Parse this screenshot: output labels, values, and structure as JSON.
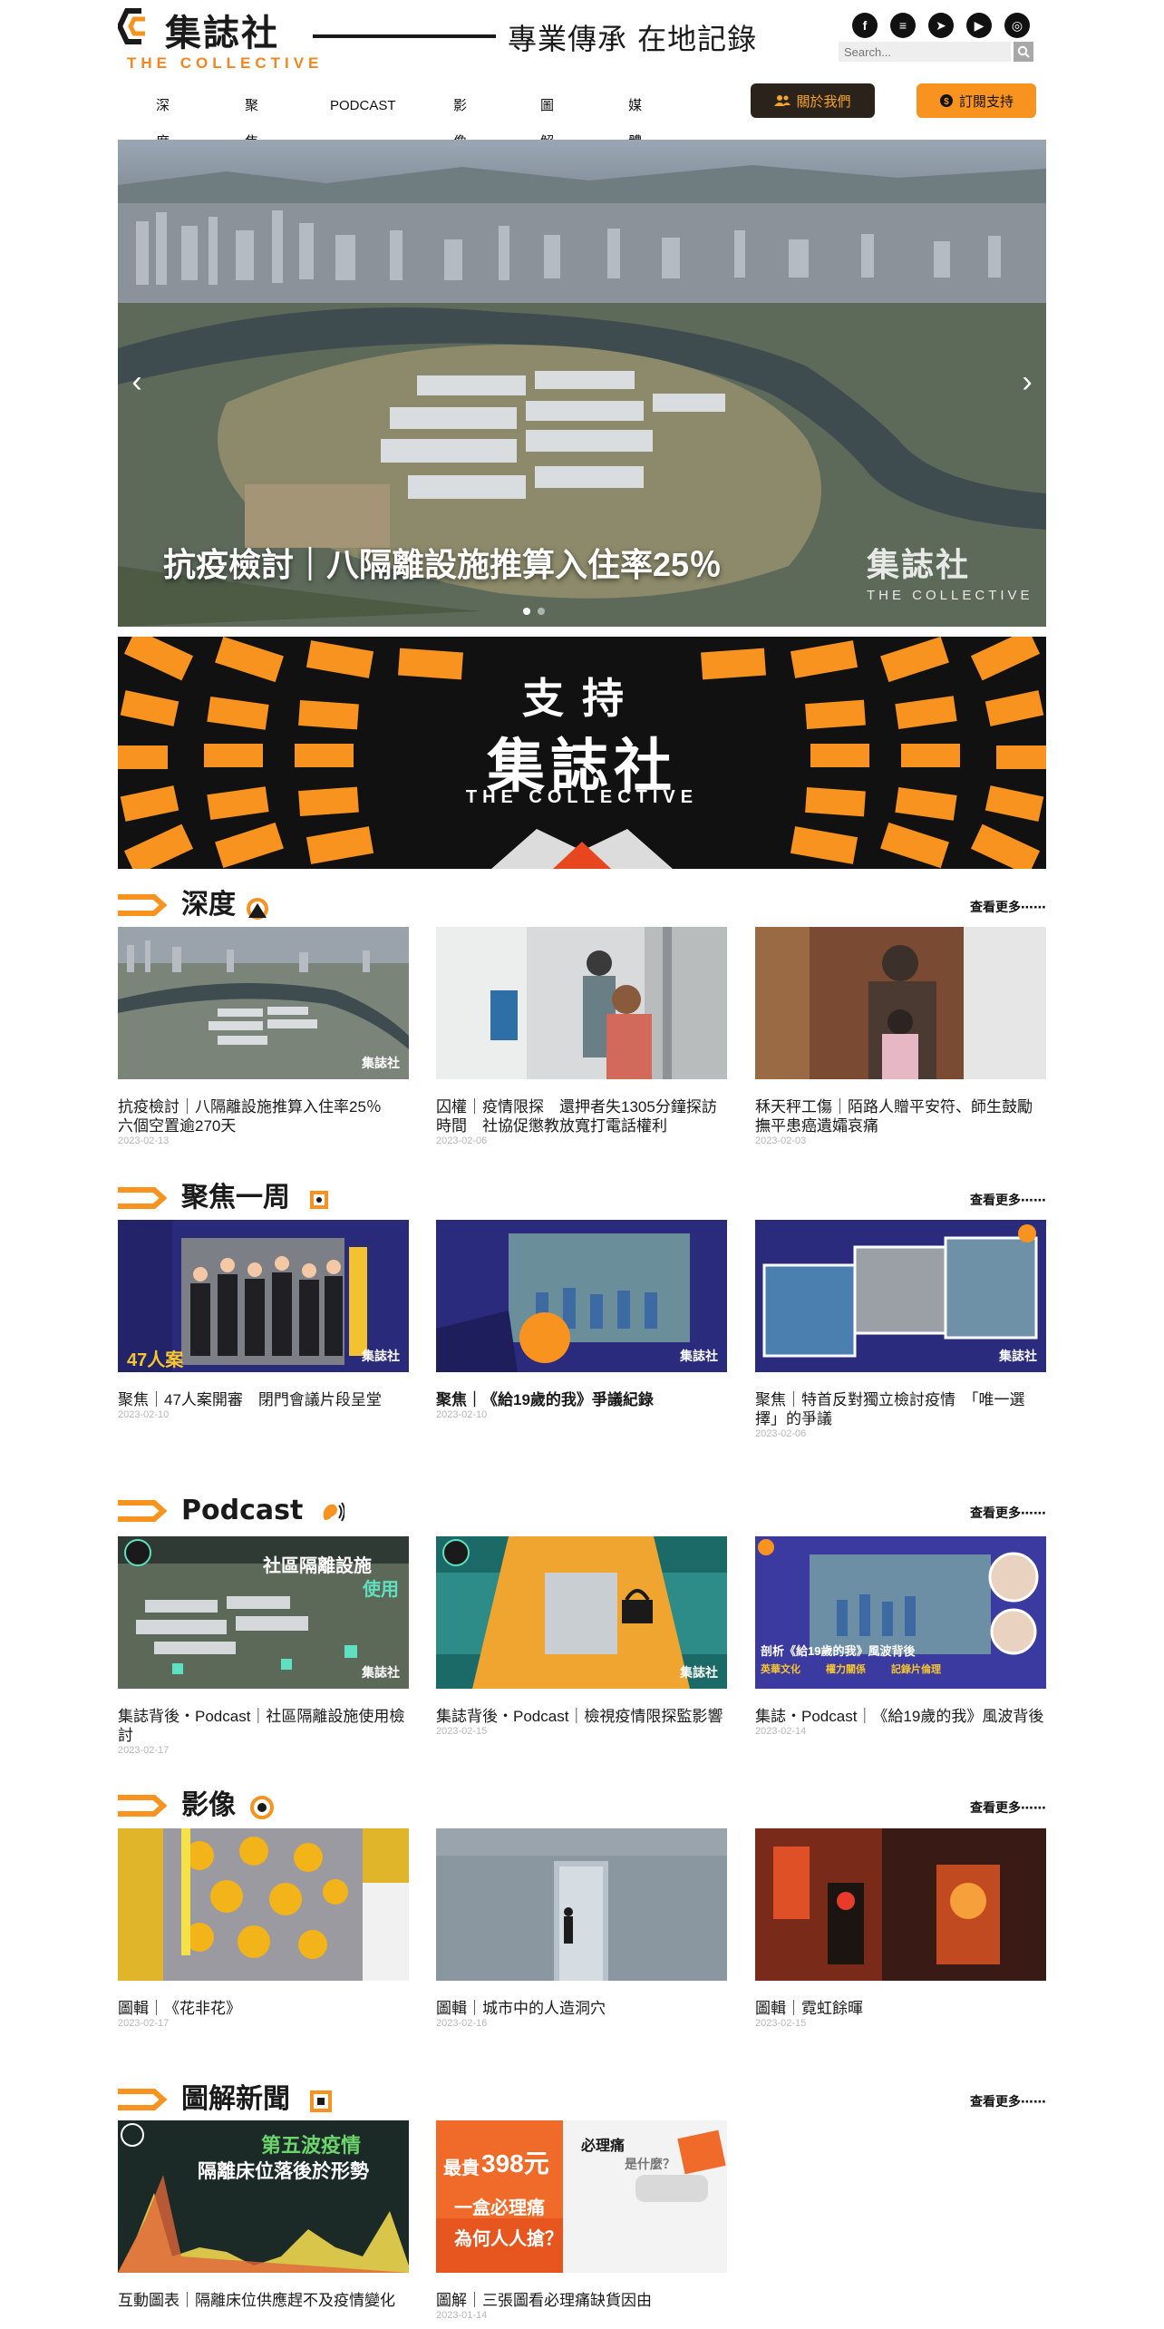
{
  "brand": {
    "logo_zh": "集誌社",
    "logo_en": "THE COLLECTIVE",
    "tagline": "專業傳承 在地記錄",
    "accent": "#f7931e",
    "dark": "#2b221c"
  },
  "social": [
    {
      "icon": "facebook-icon",
      "glyph": "f"
    },
    {
      "icon": "message-icon",
      "glyph": "≡"
    },
    {
      "icon": "telegram-icon",
      "glyph": "➤"
    },
    {
      "icon": "youtube-icon",
      "glyph": "▶"
    },
    {
      "icon": "instagram-icon",
      "glyph": "◎"
    }
  ],
  "search": {
    "placeholder": "Search..."
  },
  "nav": [
    "深度",
    "聚焦",
    "PODCAST",
    "影像",
    "圖解",
    "媒體聯乘"
  ],
  "buttons": {
    "about": "關於我們",
    "subscribe": "訂閱支持"
  },
  "hero": {
    "title": "抗疫檢討｜八隔離設施推算入住率25％",
    "watermark_zh": "集誌社",
    "watermark_en": "THE COLLECTIVE",
    "prev": "‹",
    "next": "›"
  },
  "support_banner": {
    "line1": "支持",
    "line2": "集誌社",
    "line3": "THE COLLECTIVE"
  },
  "more_label": "查看更多⋯⋯",
  "sections": {
    "depth": {
      "title": "深度",
      "items": [
        {
          "title": "抗疫檢討｜八隔離設施推算入住率25％　六個空置逾270天",
          "date": "2023-02-13"
        },
        {
          "title": "囚權｜疫情限探　還押者失1305分鐘探訪時間　社協促懲教放寬打電話權利",
          "date": "2023-02-06"
        },
        {
          "title": "秝天秤工傷｜陌路人贈平安符、師生鼓勵　撫平患癌遺孀哀痛",
          "date": "2023-02-03"
        }
      ]
    },
    "focus": {
      "title": "聚焦一周",
      "items": [
        {
          "title": "聚焦｜47人案開審　閉門會議片段呈堂",
          "date": "2023-02-10"
        },
        {
          "title": "聚焦｜《給19歲的我》爭議紀錄",
          "date": "2023-02-10"
        },
        {
          "title": "聚焦｜特首反對獨立檢討疫情　「唯一選擇」的爭議",
          "date": "2023-02-06"
        }
      ]
    },
    "podcast": {
      "title": "Podcast",
      "items": [
        {
          "title": "集誌背後・Podcast｜社區隔離設施使用檢討",
          "date": "2023-02-17"
        },
        {
          "title": "集誌背後・Podcast｜檢視疫情限探監影響",
          "date": "2023-02-15"
        },
        {
          "title": "集誌・Podcast｜《給19歲的我》風波背後",
          "date": "2023-02-14"
        }
      ]
    },
    "video": {
      "title": "影像",
      "items": [
        {
          "title": "圖輯｜《花非花》",
          "date": "2023-02-17"
        },
        {
          "title": "圖輯｜城市中的人造洞穴",
          "date": "2023-02-16"
        },
        {
          "title": "圖輯｜霓虹餘暉",
          "date": "2023-02-15"
        }
      ]
    },
    "graphic": {
      "title": "圖解新聞",
      "items": [
        {
          "title": "互動圖表｜隔離床位供應趕不及疫情變化",
          "date": ""
        },
        {
          "title": "圖解｜三張圖看必理痛缺貨因由",
          "date": "2023-01-14"
        }
      ]
    }
  },
  "thumb_text": {
    "focus1_badge": "47人案",
    "podcast1_banner": "社區隔離設施",
    "podcast1_banner2": "使用",
    "podcast3_caption": "剖析《給19歲的我》風波背後",
    "podcast3_tags": [
      "英華文化",
      "權力關係",
      "記錄片倫理"
    ],
    "graphic1_line1": "第五波疫情",
    "graphic1_line2": "隔離床位落後於形勢",
    "graphic2_price": "398元",
    "graphic2_prefix": "最貴",
    "graphic2_q1": "一盒必理痛",
    "graphic2_q2": "為何人人搶？",
    "graphic2_head": "必理痛",
    "graphic2_sub": "是什麼？",
    "wm": "集誌社"
  }
}
